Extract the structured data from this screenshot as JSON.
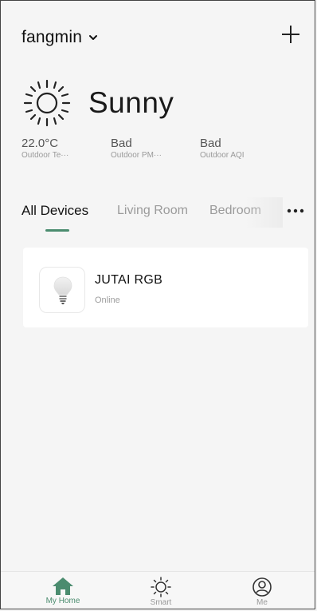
{
  "header": {
    "home_name": "fangmin"
  },
  "weather": {
    "condition": "Sunny",
    "metrics": [
      {
        "value": "22.0°C",
        "label": "Outdoor Te···"
      },
      {
        "value": "Bad",
        "label": "Outdoor PM···"
      },
      {
        "value": "Bad",
        "label": "Outdoor AQI"
      }
    ]
  },
  "tabs": [
    {
      "label": "All Devices",
      "active": true
    },
    {
      "label": "Living Room",
      "active": false
    },
    {
      "label": "Bedroom",
      "active": false
    }
  ],
  "devices": [
    {
      "name": "JUTAI  RGB",
      "status": "Online",
      "icon": "bulb-icon"
    }
  ],
  "bottom_nav": [
    {
      "label": "My Home",
      "icon": "home-icon",
      "active": true
    },
    {
      "label": "Smart",
      "icon": "sun-icon",
      "active": false
    },
    {
      "label": "Me",
      "icon": "user-icon",
      "active": false
    }
  ],
  "colors": {
    "accent": "#4b8c6f",
    "background": "#f5f5f5",
    "card": "#ffffff"
  }
}
